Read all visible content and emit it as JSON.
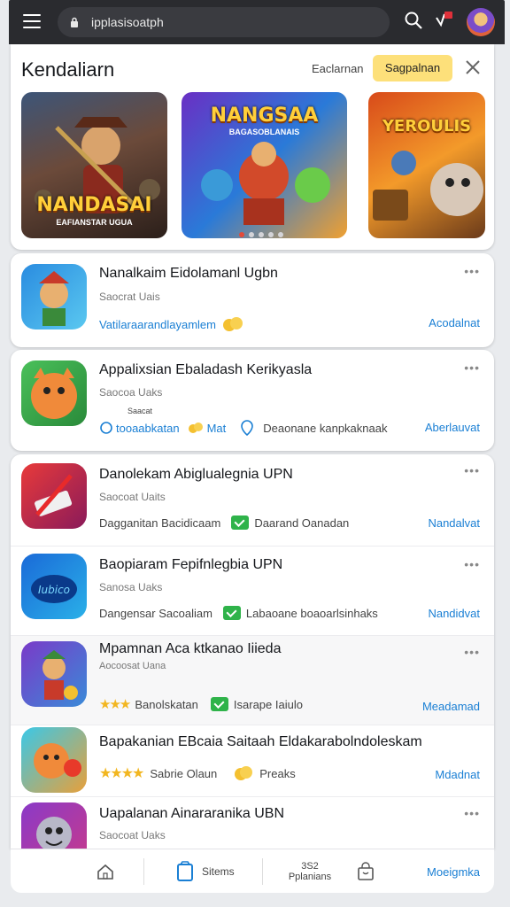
{
  "browser": {
    "url": "ipplasisoatph",
    "icons": [
      "menu-icon",
      "lock-icon",
      "search-icon",
      "notification-icon",
      "avatar"
    ]
  },
  "header": {
    "title": "Kendaliarn",
    "link": "Eaclarnan",
    "button": "Sagpalnan",
    "close_icon": "close-icon"
  },
  "banners": [
    {
      "title": "NANDASAI",
      "subtitle": "EAFIANSTAR UGUA"
    },
    {
      "title": "NANGSAA",
      "subtitle": "BAGASOBLANAIS"
    },
    {
      "title": "YEROULIS",
      "subtitle": ""
    }
  ],
  "carousel": {
    "count": 5,
    "active": 0
  },
  "apps": [
    {
      "title": "Nanalkaim Eidolamanl Ugbn",
      "sub": "Saocrat Uais",
      "meta": "Vatilaraarandlayamlem",
      "meta2": "",
      "action": "Acodalnat"
    },
    {
      "title": "Appalixsian Ebaladash Kerikyasla",
      "sub": "Saocoa Uaks",
      "meta": "tooaabkatan",
      "meta_small": "Saacat",
      "meta2": "Mat",
      "meta3": "Deaonane kanpkaknaak",
      "action": "Aberlauvat"
    },
    {
      "title": "Danolekam Abiglualegnia UPN",
      "sub": "Saocoat Uaits",
      "meta": "Dagganitan Bacidicaam",
      "meta2": "Daarand Oanadan",
      "action": "Nandalvat"
    },
    {
      "title": "Baopiaram Fepifnlegbia UPN",
      "sub": "Sanosa Uaks",
      "meta": "Dangensar Sacoaliam",
      "meta2": "Labaoane boaoarlsinhaks",
      "action": "Nandidvat"
    },
    {
      "title": "Mpamnan Aca ktkanao Iiieda",
      "sub": "Aocoosat Uana",
      "meta": "Banolskatan",
      "meta2": "Isarape Iaiulo",
      "action": "Meadamad"
    },
    {
      "title": "Bapakanian EBcaia Saitaah Eldakarabolndoleskam",
      "sub": "",
      "meta": "Sabrie Olaun",
      "meta2": "Preaks",
      "action": "Mdadnat"
    },
    {
      "title": "Uapalanan Ainararanika UBN",
      "sub": "Saocoat Uaks",
      "meta": "",
      "meta2": "",
      "action": ""
    }
  ],
  "bottom_nav": {
    "home_icon": "home-icon",
    "items_label": "Sitems",
    "count": "3S2",
    "count_label": "Pplanians",
    "bag_icon": "bag-icon",
    "action": "Moeigmka"
  },
  "colors": {
    "accent": "#1a7fd4",
    "button": "#fde07a",
    "topbar": "#2a2b2f",
    "check": "#2fb34a"
  }
}
